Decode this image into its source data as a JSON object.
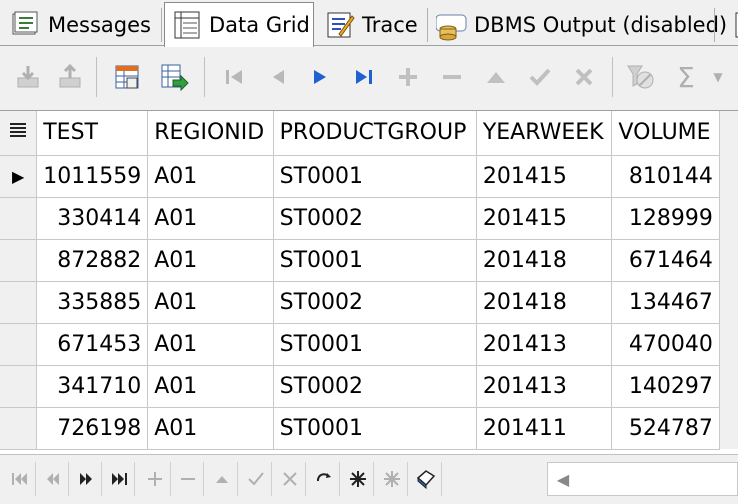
{
  "tabs": [
    {
      "label": "Messages",
      "icon": "messages-icon",
      "active": false
    },
    {
      "label": "Data Grid",
      "icon": "data-grid-icon",
      "active": true
    },
    {
      "label": "Trace",
      "icon": "trace-icon",
      "active": false
    },
    {
      "label": "DBMS Output (disabled)",
      "icon": "dbms-output-icon",
      "active": false
    }
  ],
  "grid": {
    "columns": [
      "TEST",
      "REGIONID",
      "PRODUCTGROUP",
      "YEARWEEK",
      "VOLUME"
    ],
    "rows": [
      [
        "1011559",
        "A01",
        "ST0001",
        "201415",
        "810144"
      ],
      [
        "330414",
        "A01",
        "ST0002",
        "201415",
        "128999"
      ],
      [
        "872882",
        "A01",
        "ST0001",
        "201418",
        "671464"
      ],
      [
        "335885",
        "A01",
        "ST0002",
        "201418",
        "134467"
      ],
      [
        "671453",
        "A01",
        "ST0001",
        "201413",
        "470040"
      ],
      [
        "341710",
        "A01",
        "ST0002",
        "201413",
        "140297"
      ],
      [
        "726198",
        "A01",
        "ST0001",
        "201411",
        "524787"
      ]
    ],
    "current_row_indicator": "▶"
  },
  "toolbar": {
    "sigma": "Σ"
  }
}
